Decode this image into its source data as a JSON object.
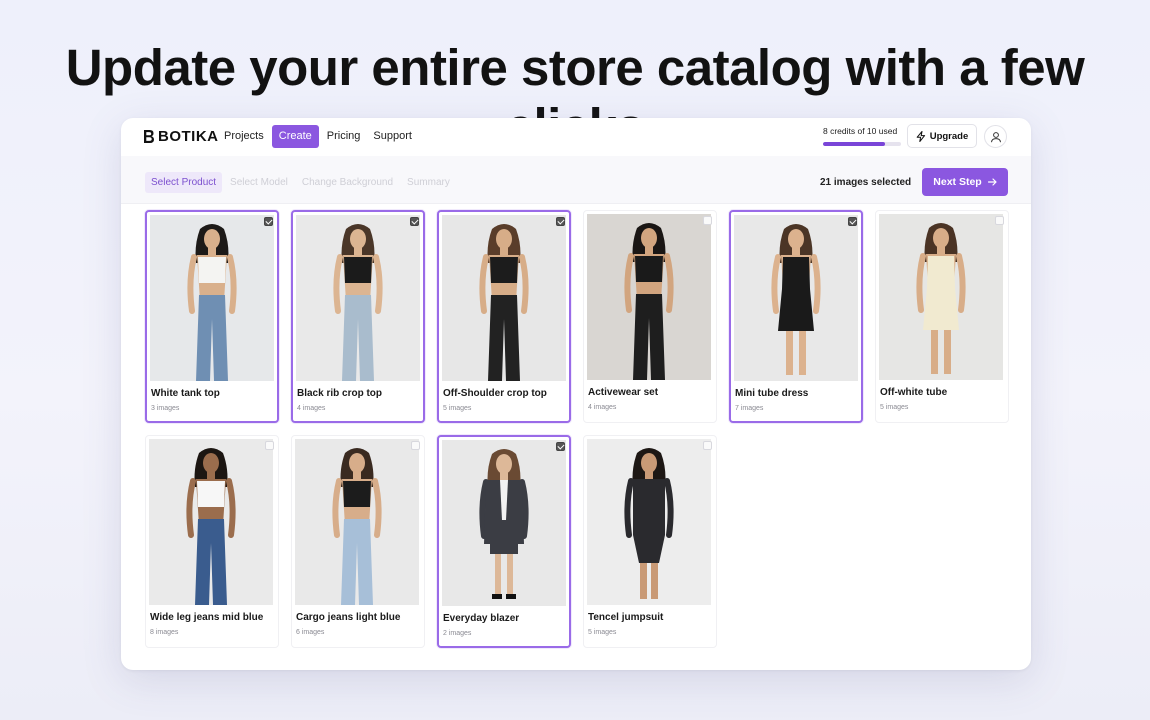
{
  "headline": "Update your entire store catalog with a few clicks",
  "app": {
    "brand": "BOTIKA",
    "nav": [
      "Projects",
      "Create",
      "Pricing",
      "Support"
    ],
    "active_nav": "Create",
    "credits_text": "8 credits of 10 used",
    "credits_used_fraction": 0.8,
    "upgrade_label": "Upgrade",
    "accent_color": "#8b57e0"
  },
  "steps": [
    "Select Product",
    "Select Model",
    "Change Background",
    "Summary"
  ],
  "selected_count_text": "21 images selected",
  "next_label": "Next Step",
  "products": [
    {
      "title": "White tank top",
      "count": "3 images",
      "selected": true
    },
    {
      "title": "Black rib crop top",
      "count": "4 images",
      "selected": true
    },
    {
      "title": "Off-Shoulder crop top",
      "count": "5 images",
      "selected": true
    },
    {
      "title": "Activewear set",
      "count": "4 images",
      "selected": false
    },
    {
      "title": "Mini tube dress",
      "count": "7 images",
      "selected": true
    },
    {
      "title": "Off-white tube",
      "count": "5 images",
      "selected": false
    },
    {
      "title": "Wide leg jeans mid blue",
      "count": "8 images",
      "selected": false
    },
    {
      "title": "Cargo jeans light blue",
      "count": "6 images",
      "selected": false
    },
    {
      "title": "Everyday blazer",
      "count": "2 images",
      "selected": true
    },
    {
      "title": "Tencel jumpsuit",
      "count": "5 images",
      "selected": false
    }
  ]
}
